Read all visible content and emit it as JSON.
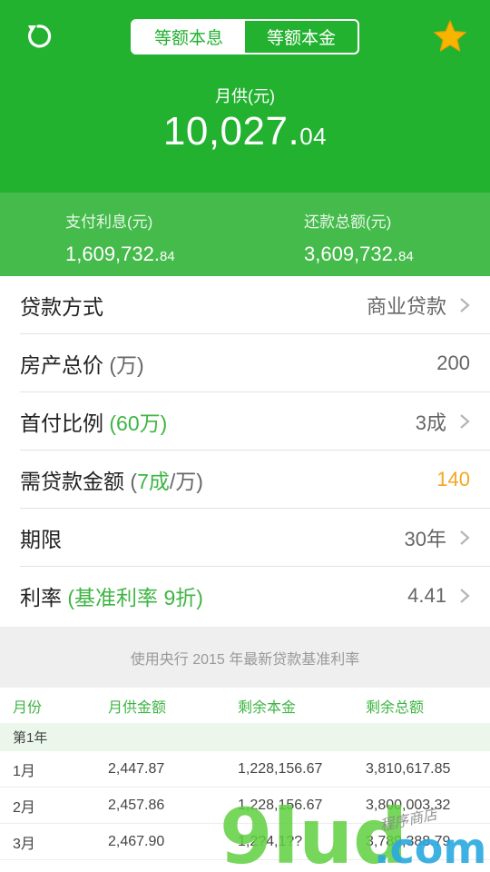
{
  "header": {
    "tabs": [
      {
        "label": "等额本息",
        "active": true
      },
      {
        "label": "等额本金",
        "active": false
      }
    ],
    "monthly_label": "月供(元)",
    "monthly_int": "10,027.",
    "monthly_dec": "04"
  },
  "summary": {
    "interest_label": "支付利息(元)",
    "interest_int": "1,609,732.",
    "interest_dec": "84",
    "total_label": "还款总额(元)",
    "total_int": "3,609,732.",
    "total_dec": "84"
  },
  "settings": {
    "loan_type": {
      "label": "贷款方式",
      "value": "商业贷款"
    },
    "price": {
      "label": "房产总价",
      "unit": "(万)",
      "value": "200"
    },
    "down": {
      "label": "首付比例",
      "hint": "(60万)",
      "value": "3成"
    },
    "loan_amount": {
      "label": "需贷款金额",
      "hint_open": "(",
      "hint_green": "7成",
      "hint_close": "/万)",
      "value": "140"
    },
    "term": {
      "label": "期限",
      "value": "30年"
    },
    "rate": {
      "label": "利率",
      "hint": "(基准利率 9折)",
      "value": "4.41"
    }
  },
  "note": "使用央行 2015 年最新贷款基准利率",
  "table": {
    "headers": [
      "月份",
      "月供金额",
      "剩余本金",
      "剩余总额"
    ],
    "year_label": "第1年",
    "rows": [
      [
        "1月",
        "2,447.87",
        "1,228,156.67",
        "3,810,617.85"
      ],
      [
        "2月",
        "2,457.86",
        "1,228,156.67",
        "3,800,003.32"
      ],
      [
        "3月",
        "2,467.90",
        "1,2?4,1??",
        "3,789,388.79"
      ]
    ]
  },
  "watermark": {
    "brand": "9lud",
    "suffix": ".com",
    "tagline": "程序商店"
  },
  "colors": {
    "primary": "#23b130",
    "summary_bg": "#45bb4b",
    "accent_orange": "#f5a623",
    "star": "#f7b500"
  }
}
